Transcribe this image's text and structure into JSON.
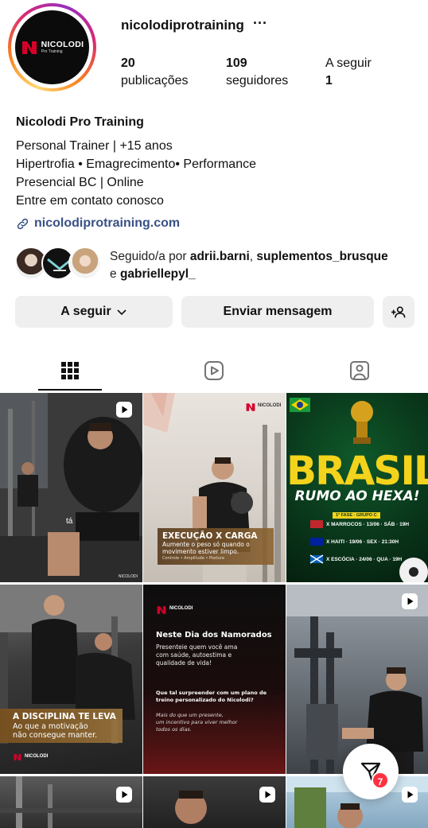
{
  "profile": {
    "username": "nicolodiprotraining",
    "more": "···",
    "avatar_logo_text": "NICOLODI",
    "avatar_logo_sub": "Pro Training",
    "stats": [
      {
        "num": "20",
        "label": "publicações"
      },
      {
        "num": "109",
        "label": "seguidores"
      },
      {
        "num": "A seguir",
        "label": "1"
      }
    ],
    "full_name": "Nicolodi Pro Training",
    "bio": [
      "Personal Trainer | +15 anos",
      "Hipertrofia • Emagrecimento• Performance",
      "Presencial BC | Online",
      "Entre em contato conosco"
    ],
    "link": "nicolodiprotraining.com",
    "followed_prefix": "Seguido/a por ",
    "followed_users": [
      "adrii.barni",
      "suplementos_brusque",
      "gabriellepyl_"
    ],
    "followed_sep": ", ",
    "followed_and": "e "
  },
  "actions": {
    "following_label": "A seguir",
    "message_label": "Enviar mensagem"
  },
  "tabs": [
    "posts-grid",
    "reels",
    "tagged"
  ],
  "posts": [
    {
      "caption": "tá"
    },
    {
      "title": "EXECUÇÃO X CARGA",
      "lines": [
        "Aumente o peso só quando o",
        "movimento estiver limpo."
      ],
      "tags": "Controle • Amplitude • Postura",
      "brand": "NICOLODI"
    },
    {
      "title": "BRASIL",
      "subtitle": "RUMO AO HEXA!",
      "phase": "1ª FASE · GRUPO C",
      "matches": [
        "X MARROCOS · 13/06 · SÁB · 19H",
        "X HAITI · 19/06 · SEX · 21:30H",
        "X ESCÓCIA · 24/06 · QUA · 19H"
      ]
    },
    {
      "title": "A DISCIPLINA TE LEVA",
      "lines": [
        "Ao que a motivação",
        "não consegue manter."
      ],
      "brand": "NICOLODI"
    },
    {
      "brand": "NICOLODI",
      "title": "Neste Dia dos Namorados",
      "p1": [
        "Presenteie quem você ama",
        "com saúde, autoestima e",
        "qualidade de vida!"
      ],
      "p2": [
        "Que tal surpreender com um plano de",
        "treino personalizado do Nicolodi?"
      ],
      "p3": [
        "Mais do que um presente,",
        "um incentivo para viver melhor",
        "todos os dias."
      ]
    },
    {},
    {},
    {},
    {}
  ],
  "fab": {
    "badge": "7"
  },
  "colors": {
    "link": "#385185",
    "button_bg": "#efefef",
    "badge": "#ff3040",
    "brand_red": "#c8102e"
  }
}
